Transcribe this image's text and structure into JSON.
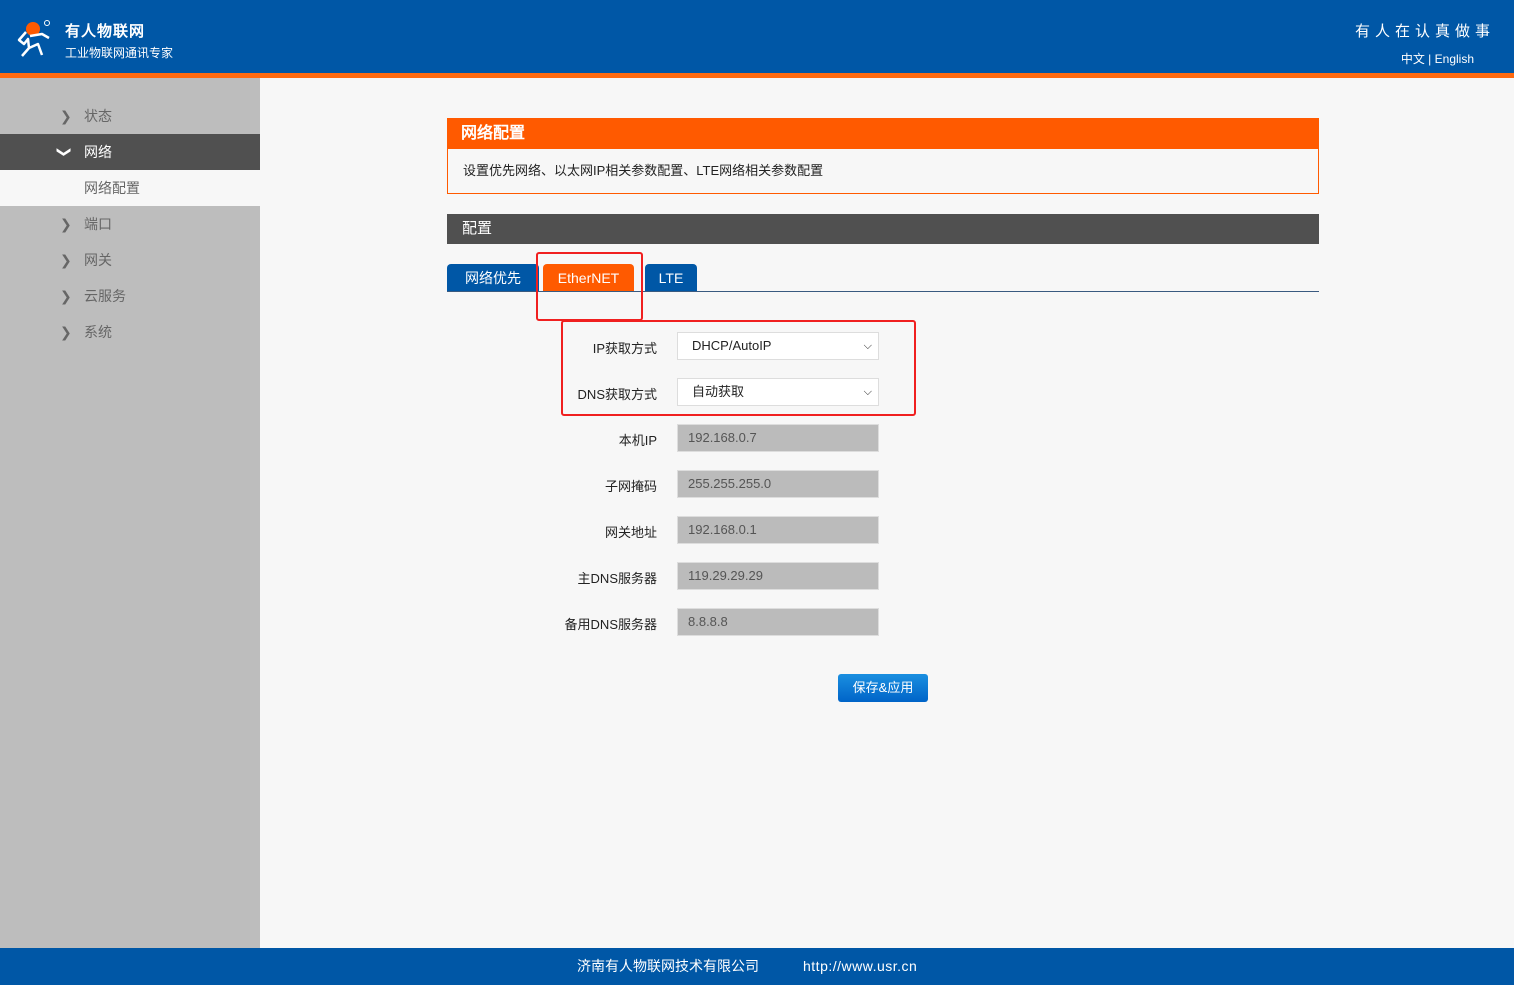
{
  "header": {
    "brand": "有人物联网",
    "brand_sub": "工业物联网通讯专家",
    "slogan": "有人在认真做事",
    "lang_zh": "中文",
    "lang_sep": "|",
    "lang_en": "English"
  },
  "sidebar": {
    "items": [
      {
        "label": "状态"
      },
      {
        "label": "网络"
      },
      {
        "label": "网络配置"
      },
      {
        "label": "端口"
      },
      {
        "label": "网关"
      },
      {
        "label": "云服务"
      },
      {
        "label": "系统"
      }
    ]
  },
  "panel": {
    "title": "网络配置",
    "description": "设置优先网络、以太网IP相关参数配置、LTE网络相关参数配置"
  },
  "config": {
    "title": "配置",
    "tabs": [
      {
        "label": "网络优先"
      },
      {
        "label": "EtherNET"
      },
      {
        "label": "LTE"
      }
    ]
  },
  "form": {
    "ip_mode": {
      "label": "IP获取方式",
      "value": "DHCP/AutoIP"
    },
    "dns_mode": {
      "label": "DNS获取方式",
      "value": "自动获取"
    },
    "local_ip": {
      "label": "本机IP",
      "value": "192.168.0.7"
    },
    "subnet": {
      "label": "子网掩码",
      "value": "255.255.255.0"
    },
    "gateway": {
      "label": "网关地址",
      "value": "192.168.0.1"
    },
    "dns1": {
      "label": "主DNS服务器",
      "value": "119.29.29.29"
    },
    "dns2": {
      "label": "备用DNS服务器",
      "value": "8.8.8.8"
    },
    "save_label": "保存&应用"
  },
  "footer": {
    "company": "济南有人物联网技术有限公司",
    "url": "http://www.usr.cn"
  },
  "colors": {
    "brand_blue": "#0057a6",
    "accent_orange": "#ff5a00",
    "highlight_red": "#f02020"
  }
}
